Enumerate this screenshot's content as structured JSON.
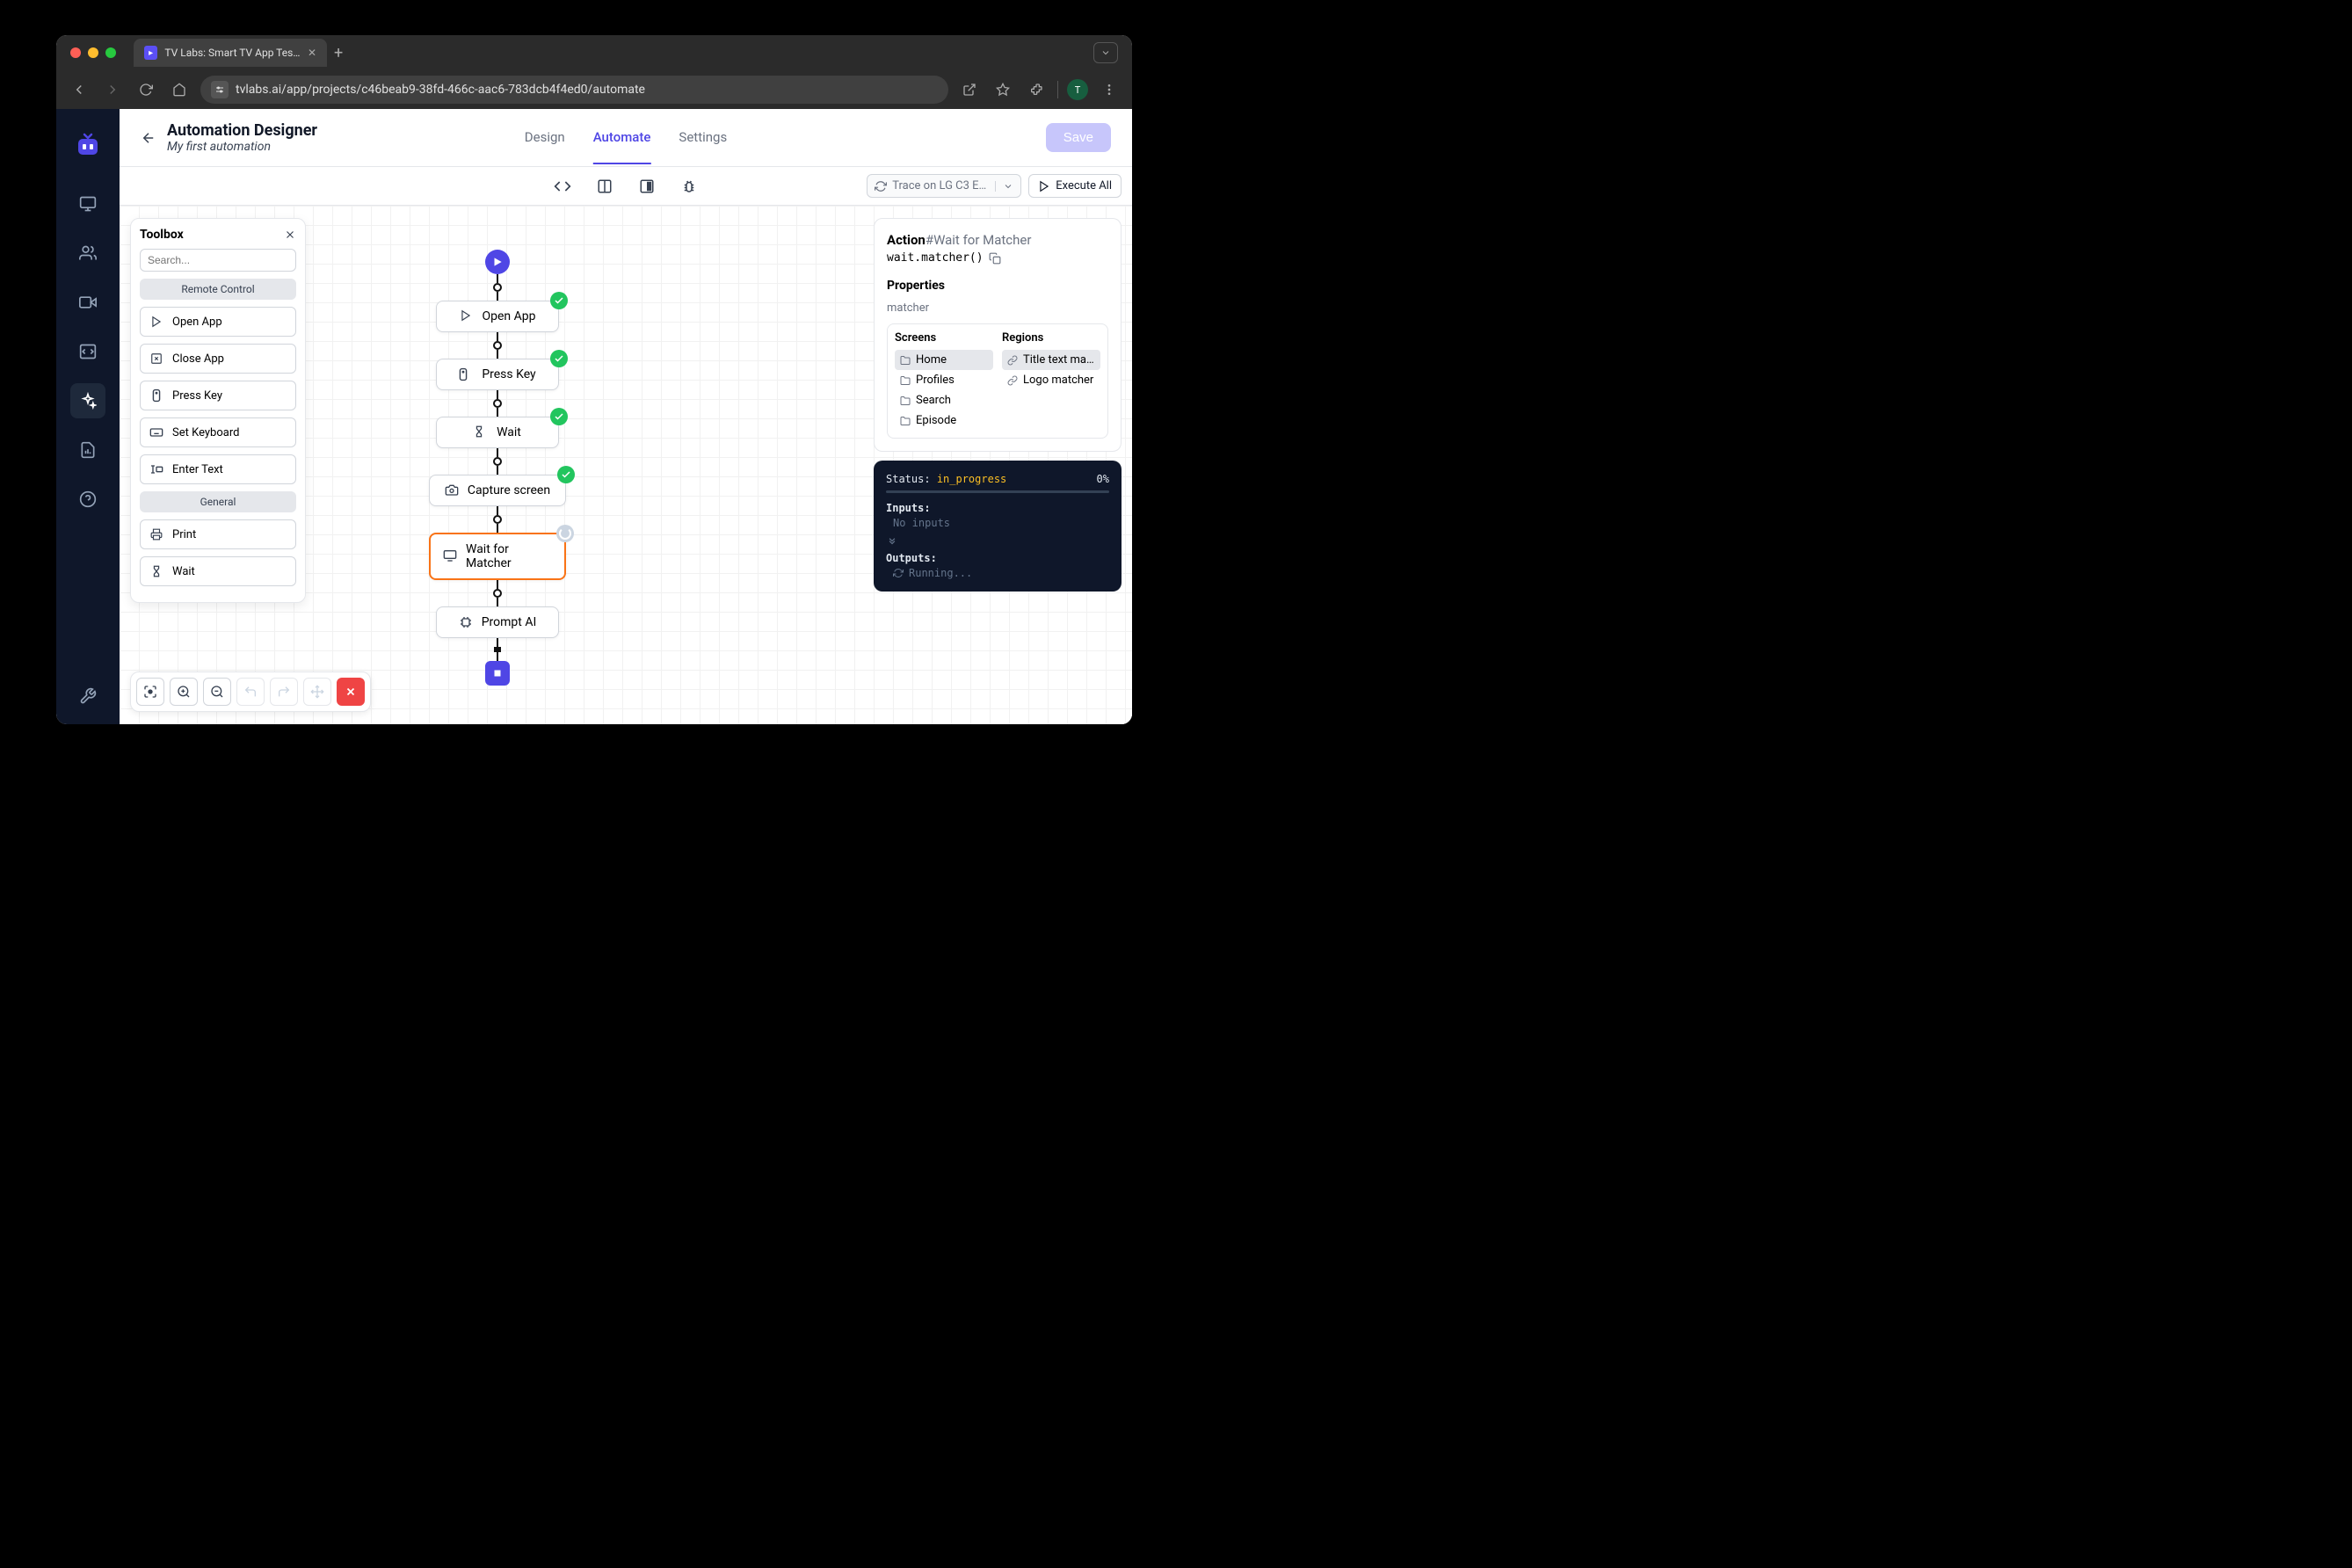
{
  "browser": {
    "tab_title": "TV Labs: Smart TV App Testi…",
    "url": "tvlabs.ai/app/projects/c46beab9-38fd-466c-aac6-783dcb4f4ed0/automate",
    "avatar_letter": "T"
  },
  "header": {
    "title": "Automation Designer",
    "subtitle": "My first automation",
    "tabs": [
      "Design",
      "Automate",
      "Settings"
    ],
    "active_tab": "Automate",
    "save_label": "Save"
  },
  "toolbar": {
    "trace_label": "Trace on LG C3 E…",
    "execute_label": "Execute All"
  },
  "toolbox": {
    "title": "Toolbox",
    "search_placeholder": "Search...",
    "groups": [
      {
        "label": "Remote Control",
        "items": [
          "Open App",
          "Close App",
          "Press Key",
          "Set Keyboard",
          "Enter Text"
        ]
      },
      {
        "label": "General",
        "items": [
          "Print",
          "Wait"
        ]
      }
    ]
  },
  "flow": {
    "nodes": [
      {
        "label": "Open App",
        "status": "success",
        "icon": "play"
      },
      {
        "label": "Press Key",
        "status": "success",
        "icon": "remote"
      },
      {
        "label": "Wait",
        "status": "success",
        "icon": "hourglass"
      },
      {
        "label": "Capture screen",
        "status": "success",
        "icon": "camera",
        "wide": true
      },
      {
        "label": "Wait for Matcher",
        "status": "pending",
        "selected": true,
        "icon": "monitor",
        "wide": true
      },
      {
        "label": "Prompt AI",
        "status": "none",
        "icon": "chip"
      }
    ]
  },
  "action": {
    "title": "Action",
    "hash": "#Wait for Matcher",
    "code": "wait.matcher()",
    "properties_label": "Properties",
    "matcher_label": "matcher",
    "screens_label": "Screens",
    "regions_label": "Regions",
    "screens": [
      {
        "label": "Home",
        "selected": true
      },
      {
        "label": "Profiles"
      },
      {
        "label": "Search"
      },
      {
        "label": "Episode"
      }
    ],
    "regions": [
      {
        "label": "Title text ma…",
        "selected": true
      },
      {
        "label": "Logo matcher"
      }
    ]
  },
  "status": {
    "status_label": "Status:",
    "status_value": "in_progress",
    "percent": "0%",
    "inputs_label": "Inputs:",
    "inputs_value": "No inputs",
    "outputs_label": "Outputs:",
    "running_label": "Running..."
  }
}
